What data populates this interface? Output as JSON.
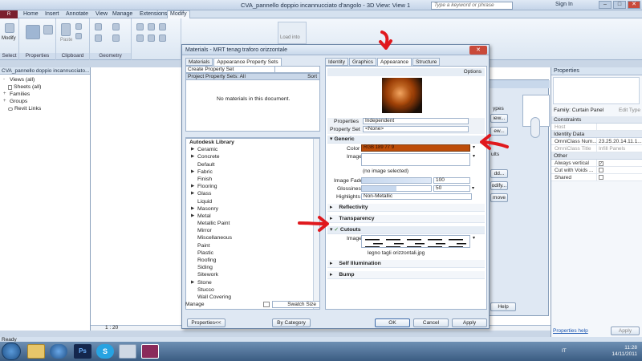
{
  "window": {
    "title": "CVA_pannello doppio incannucciato d'angolo - 3D View: View 1",
    "search_placeholder": "Type a keyword or phrase",
    "sign_in": "Sign In"
  },
  "ribbon_tabs": [
    "Home",
    "Insert",
    "Annotate",
    "View",
    "Manage",
    "Extensions",
    "Modify"
  ],
  "ribbon_groups": [
    "Select",
    "Properties",
    "Clipboard",
    "Geometry"
  ],
  "ribbon_buttons": {
    "modify": "Modify",
    "paste": "Paste",
    "load_into": "Load into"
  },
  "project_browser": {
    "title": "CVA_pannello doppio incannucciato...",
    "items": [
      {
        "label": "Views (all)",
        "expander": "-"
      },
      {
        "label": "Sheets (all)",
        "expander": ""
      },
      {
        "label": "Families",
        "expander": "+"
      },
      {
        "label": "Groups",
        "expander": "+"
      },
      {
        "label": "Revit Links",
        "expander": ""
      }
    ]
  },
  "view_scale": "1 : 20",
  "status": "Ready",
  "properties_panel": {
    "title": "Properties",
    "family": "Family: Curtain Panel",
    "edit_type": "Edit Type",
    "sections": [
      {
        "name": "Constraints",
        "rows": [
          {
            "k": "Host",
            "v": "",
            "disabled": true
          }
        ]
      },
      {
        "name": "Identity Data",
        "rows": [
          {
            "k": "OmniClass Num...",
            "v": "23.25.20.14.11.1..."
          },
          {
            "k": "OmniClass Title",
            "v": "Infill Panels",
            "disabled": true
          }
        ]
      },
      {
        "name": "Other",
        "rows": [
          {
            "k": "Always vertical",
            "v": "✓",
            "check": true
          },
          {
            "k": "Cut with Voids ...",
            "v": "",
            "check": true
          },
          {
            "k": "Shared",
            "v": "",
            "check": true
          }
        ]
      }
    ],
    "help_link": "Properties help",
    "apply": "Apply"
  },
  "background_dialog": {
    "labels": [
      "ypes",
      "iew...",
      "ew...",
      "ults",
      "dd...",
      "odify...",
      "move",
      "Help"
    ]
  },
  "dialog": {
    "title": "Materials - MRT tenag traforo orizzontale",
    "left_tabs": [
      "Materials",
      "Appearance Property Sets"
    ],
    "create_set": "Create Property Set",
    "project_sets": "Project Property Sets: All",
    "sort": "Sort",
    "empty_msg": "No materials in this document.",
    "library_title": "Autodesk Library",
    "library_items": [
      {
        "label": "Ceramic",
        "arrow": true
      },
      {
        "label": "Concrete",
        "arrow": true
      },
      {
        "label": "Default",
        "arrow": false
      },
      {
        "label": "Fabric",
        "arrow": true
      },
      {
        "label": "Finish",
        "arrow": false
      },
      {
        "label": "Flooring",
        "arrow": true
      },
      {
        "label": "Glass",
        "arrow": true
      },
      {
        "label": "Liquid",
        "arrow": false
      },
      {
        "label": "Masonry",
        "arrow": true
      },
      {
        "label": "Metal",
        "arrow": true
      },
      {
        "label": "Metallic Paint",
        "arrow": false
      },
      {
        "label": "Mirror",
        "arrow": false
      },
      {
        "label": "Miscellaneous",
        "arrow": false
      },
      {
        "label": "Paint",
        "arrow": false
      },
      {
        "label": "Plastic",
        "arrow": false
      },
      {
        "label": "Roofing",
        "arrow": false
      },
      {
        "label": "Siding",
        "arrow": false
      },
      {
        "label": "Sitework",
        "arrow": false
      },
      {
        "label": "Stone",
        "arrow": true
      },
      {
        "label": "Stucco",
        "arrow": false
      },
      {
        "label": "Wall Covering",
        "arrow": false
      }
    ],
    "manage": "Manage",
    "swatch_size": "Swatch Size",
    "right_tabs": [
      "Identity",
      "Graphics",
      "Appearance",
      "Structure"
    ],
    "active_right_tab": "Appearance",
    "options": "Options",
    "properties_label": "Properties",
    "properties_value": "Independent",
    "property_set_label": "Property Set",
    "property_set_value": "<None>",
    "generic": "Generic",
    "color_label": "Color",
    "color_value": "RGB 189 77 9",
    "color_hex": "#bd4d09",
    "image_label": "Image",
    "image_none": "(no image selected)",
    "image_fade_label": "Image Fade",
    "image_fade_value": "100",
    "glossiness_label": "Glossiness",
    "glossiness_value": "50",
    "highlights_label": "Highlights",
    "highlights_value": "Non-Metallic",
    "reflectivity": "Reflectivity",
    "transparency": "Transparency",
    "cutouts": "Cutouts",
    "cutouts_image_label": "Image",
    "cutouts_file": "legno tagli orizzontali.jpg",
    "self_illumination": "Self Illumination",
    "bump": "Bump",
    "buttons": {
      "properties": "Properties<<",
      "by_category": "By Category",
      "ok": "OK",
      "cancel": "Cancel",
      "apply": "Apply"
    }
  },
  "taskbar": {
    "clock_time": "11:28",
    "clock_date": "14/11/2011",
    "lang": "IT"
  },
  "colors": {
    "arrow_red": "#e0181d",
    "accent": "#bd4d09"
  }
}
